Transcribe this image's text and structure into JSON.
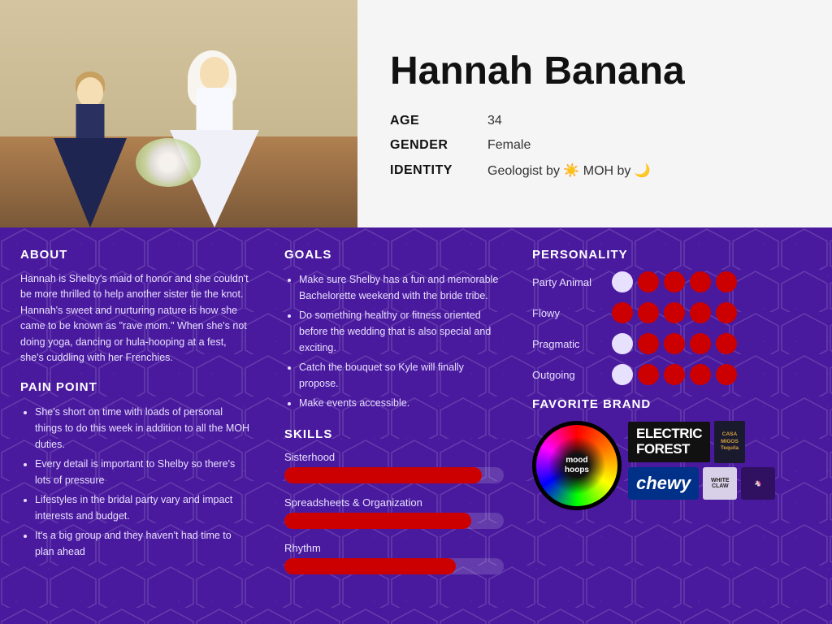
{
  "header": {
    "name": "Hannah Banana",
    "age_label": "AGE",
    "age_value": "34",
    "gender_label": "GENDER",
    "gender_value": "Female",
    "identity_label": "IDENTITY",
    "identity_value": "Geologist by ☀️ MOH by 🌙"
  },
  "about": {
    "title": "ABOUT",
    "text": "Hannah is Shelby's maid of honor and she couldn't be more thrilled to help another sister tie the knot. Hannah's sweet and nurturing nature is how she came to be known as \"rave mom.\" When she's not doing yoga, dancing or hula-hooping at a fest, she's cuddling with her Frenchies."
  },
  "pain_point": {
    "title": "PAIN POINT",
    "items": [
      "She's short on time with loads of personal things to do this week in addition to all the MOH duties.",
      "Every detail is important to Shelby so there's lots of pressure",
      "Lifestyles in the bridal party vary and impact interests and budget.",
      "It's a big group and they haven't had time to plan ahead"
    ]
  },
  "goals": {
    "title": "GOALS",
    "items": [
      "Make sure Shelby has a fun and memorable Bachelorette weekend with the bride tribe.",
      "Do something healthy or fitness oriented before the wedding that is also special and exciting.",
      "Catch the bouquet so Kyle will finally propose.",
      "Make events accessible."
    ]
  },
  "skills": {
    "title": "SKILLS",
    "items": [
      {
        "label": "Sisterhood",
        "percent": 90
      },
      {
        "label": "Spreadsheets & Organization",
        "percent": 85
      },
      {
        "label": "Rhythm",
        "percent": 78
      }
    ]
  },
  "personality": {
    "title": "PERSONALITY",
    "traits": [
      {
        "name": "Party Animal",
        "filled": 4,
        "empty": 1
      },
      {
        "name": "Flowy",
        "filled": 5,
        "empty": 0
      },
      {
        "name": "Pragmatic",
        "filled": 4,
        "empty": 1
      },
      {
        "name": "Outgoing",
        "filled": 4,
        "empty": 1
      }
    ]
  },
  "favorite_brand": {
    "title": "FAVORITE BRAND",
    "brands": [
      {
        "name": "Mood Hoops",
        "id": "moodhoops"
      },
      {
        "name": "Electric Forest",
        "id": "electric-forest"
      },
      {
        "name": "Casamigos",
        "id": "casamigos"
      },
      {
        "name": "Chewy",
        "id": "chewy"
      },
      {
        "name": "White Claw",
        "id": "whiteclaw"
      },
      {
        "name": "Other",
        "id": "other"
      }
    ]
  },
  "colors": {
    "background_dark": "#4a1a9e",
    "dot_filled": "#cc0000",
    "dot_empty": "#e8e0ff",
    "bar_fill": "#cc0000",
    "text_light": "#e8e0ff"
  }
}
